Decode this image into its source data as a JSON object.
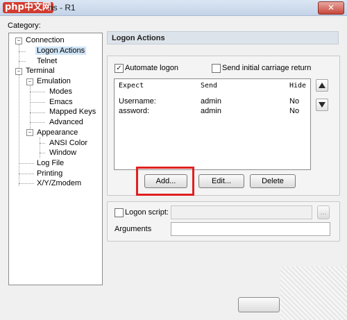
{
  "window": {
    "logo_text": "php中文网",
    "title": "ns - R1",
    "close_glyph": "✕"
  },
  "category_label": "Category:",
  "tree": {
    "items": [
      {
        "label": "Connection"
      },
      {
        "label": "Logon Actions"
      },
      {
        "label": "Telnet"
      },
      {
        "label": "Terminal"
      },
      {
        "label": "Emulation"
      },
      {
        "label": "Modes"
      },
      {
        "label": "Emacs"
      },
      {
        "label": "Mapped Keys"
      },
      {
        "label": "Advanced"
      },
      {
        "label": "Appearance"
      },
      {
        "label": "ANSI Color"
      },
      {
        "label": "Window"
      },
      {
        "label": "Log File"
      },
      {
        "label": "Printing"
      },
      {
        "label": "X/Y/Zmodem"
      }
    ],
    "selected": "Logon Actions",
    "toggle_glyph": "−"
  },
  "panel": {
    "header": "Logon Actions",
    "automate_logon": {
      "label": "Automate logon",
      "checked": true,
      "mark": "✓"
    },
    "send_cr": {
      "label": "Send initial carriage return",
      "checked": false
    },
    "table": {
      "columns": [
        "Expect",
        "Send",
        "Hide"
      ],
      "rows": [
        {
          "expect": "Username:",
          "send": "admin",
          "hide": "No"
        },
        {
          "expect": "assword:",
          "send": "admin",
          "hide": "No"
        }
      ]
    },
    "buttons": {
      "add": "Add...",
      "edit": "Edit...",
      "delete": "Delete"
    },
    "logon_script": {
      "label": "Logon script:",
      "browse_label": "...",
      "checked": false
    },
    "arguments": {
      "label": "Arguments",
      "value": ""
    }
  },
  "colors": {
    "highlight": "#e02020",
    "section_header": "#dde3ea",
    "selection": "#cfe4f7"
  },
  "icons": [
    "arrow-up-icon",
    "arrow-down-icon",
    "check-icon",
    "tree-collapse-icon"
  ]
}
